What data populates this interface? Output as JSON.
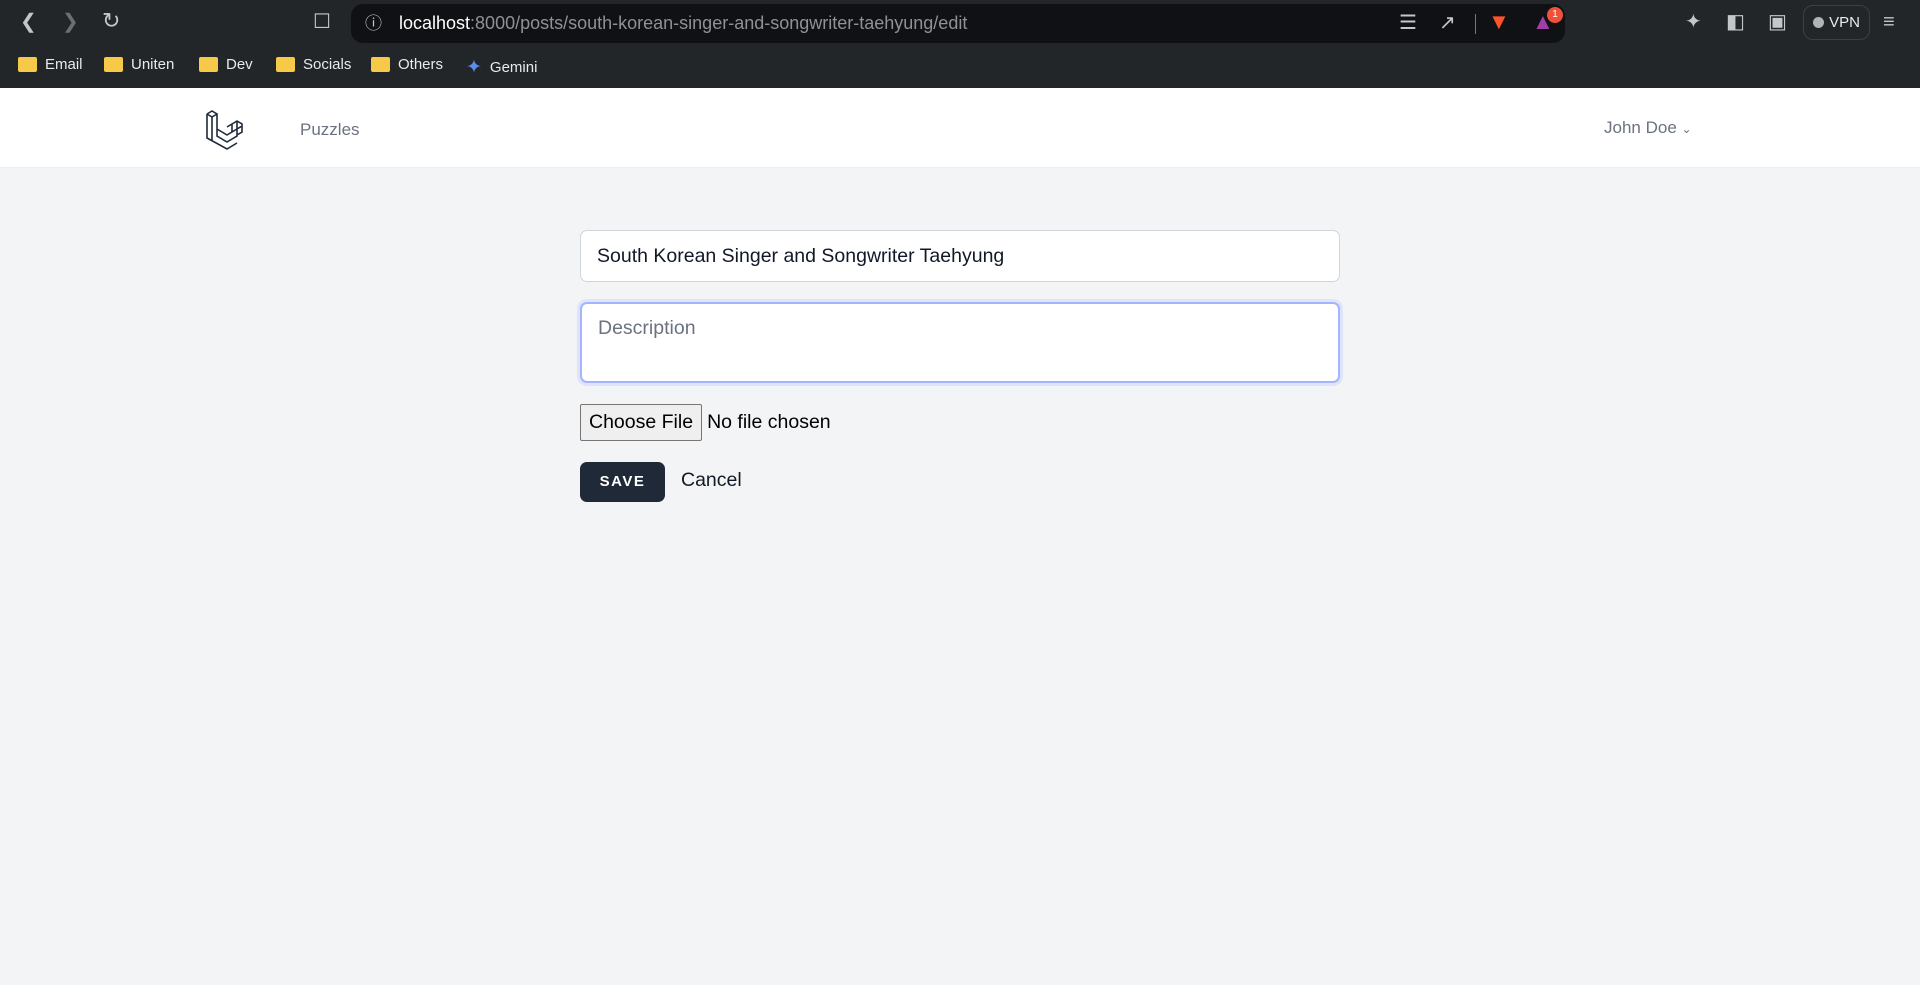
{
  "browser": {
    "url_host": "localhost",
    "url_path": ":8000/posts/south-korean-singer-and-songwriter-taehyung/edit",
    "vpn_label": "VPN",
    "notification_count": "1",
    "bookmarks": [
      {
        "label": "Email",
        "icon": "folder-icon"
      },
      {
        "label": "Uniten",
        "icon": "folder-icon"
      },
      {
        "label": "Dev",
        "icon": "folder-icon"
      },
      {
        "label": "Socials",
        "icon": "folder-icon"
      },
      {
        "label": "Others",
        "icon": "folder-icon"
      },
      {
        "label": "Gemini",
        "icon": "gemini-icon"
      }
    ]
  },
  "nav": {
    "logo": "laravel-logo",
    "link": "Puzzles",
    "user": "John Doe"
  },
  "form": {
    "title_value": "South Korean Singer and Songwriter Taehyung",
    "description_placeholder": "Description",
    "file_button": "Choose File",
    "file_status": "No file chosen",
    "save": "SAVE",
    "cancel": "Cancel"
  },
  "colors": {
    "primary_button": "#1f2937",
    "focus_ring": "#a5b4fc",
    "brave": "#fb542b"
  }
}
